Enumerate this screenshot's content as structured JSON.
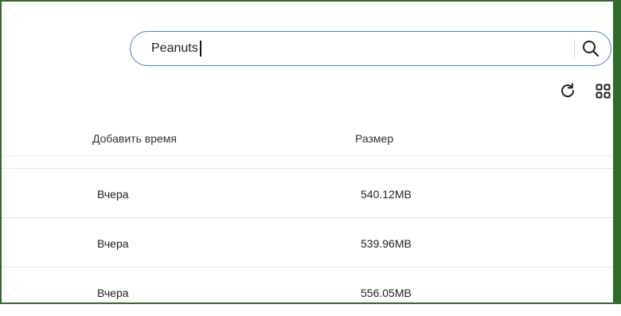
{
  "search": {
    "value": "Peanuts",
    "icon": "search-icon"
  },
  "toolbar": {
    "refresh_icon": "refresh-icon",
    "grid_icon": "grid-view-icon"
  },
  "table": {
    "columns": [
      "Добавить время",
      "Размер"
    ],
    "rows": [
      {
        "time": "Вчера",
        "size": "540.12MB"
      },
      {
        "time": "Вчера",
        "size": "539.96MB"
      },
      {
        "time": "Вчера",
        "size": "556.05MB"
      }
    ]
  },
  "colors": {
    "accent": "#4a7fe0",
    "frame": "#2f6b2f"
  }
}
